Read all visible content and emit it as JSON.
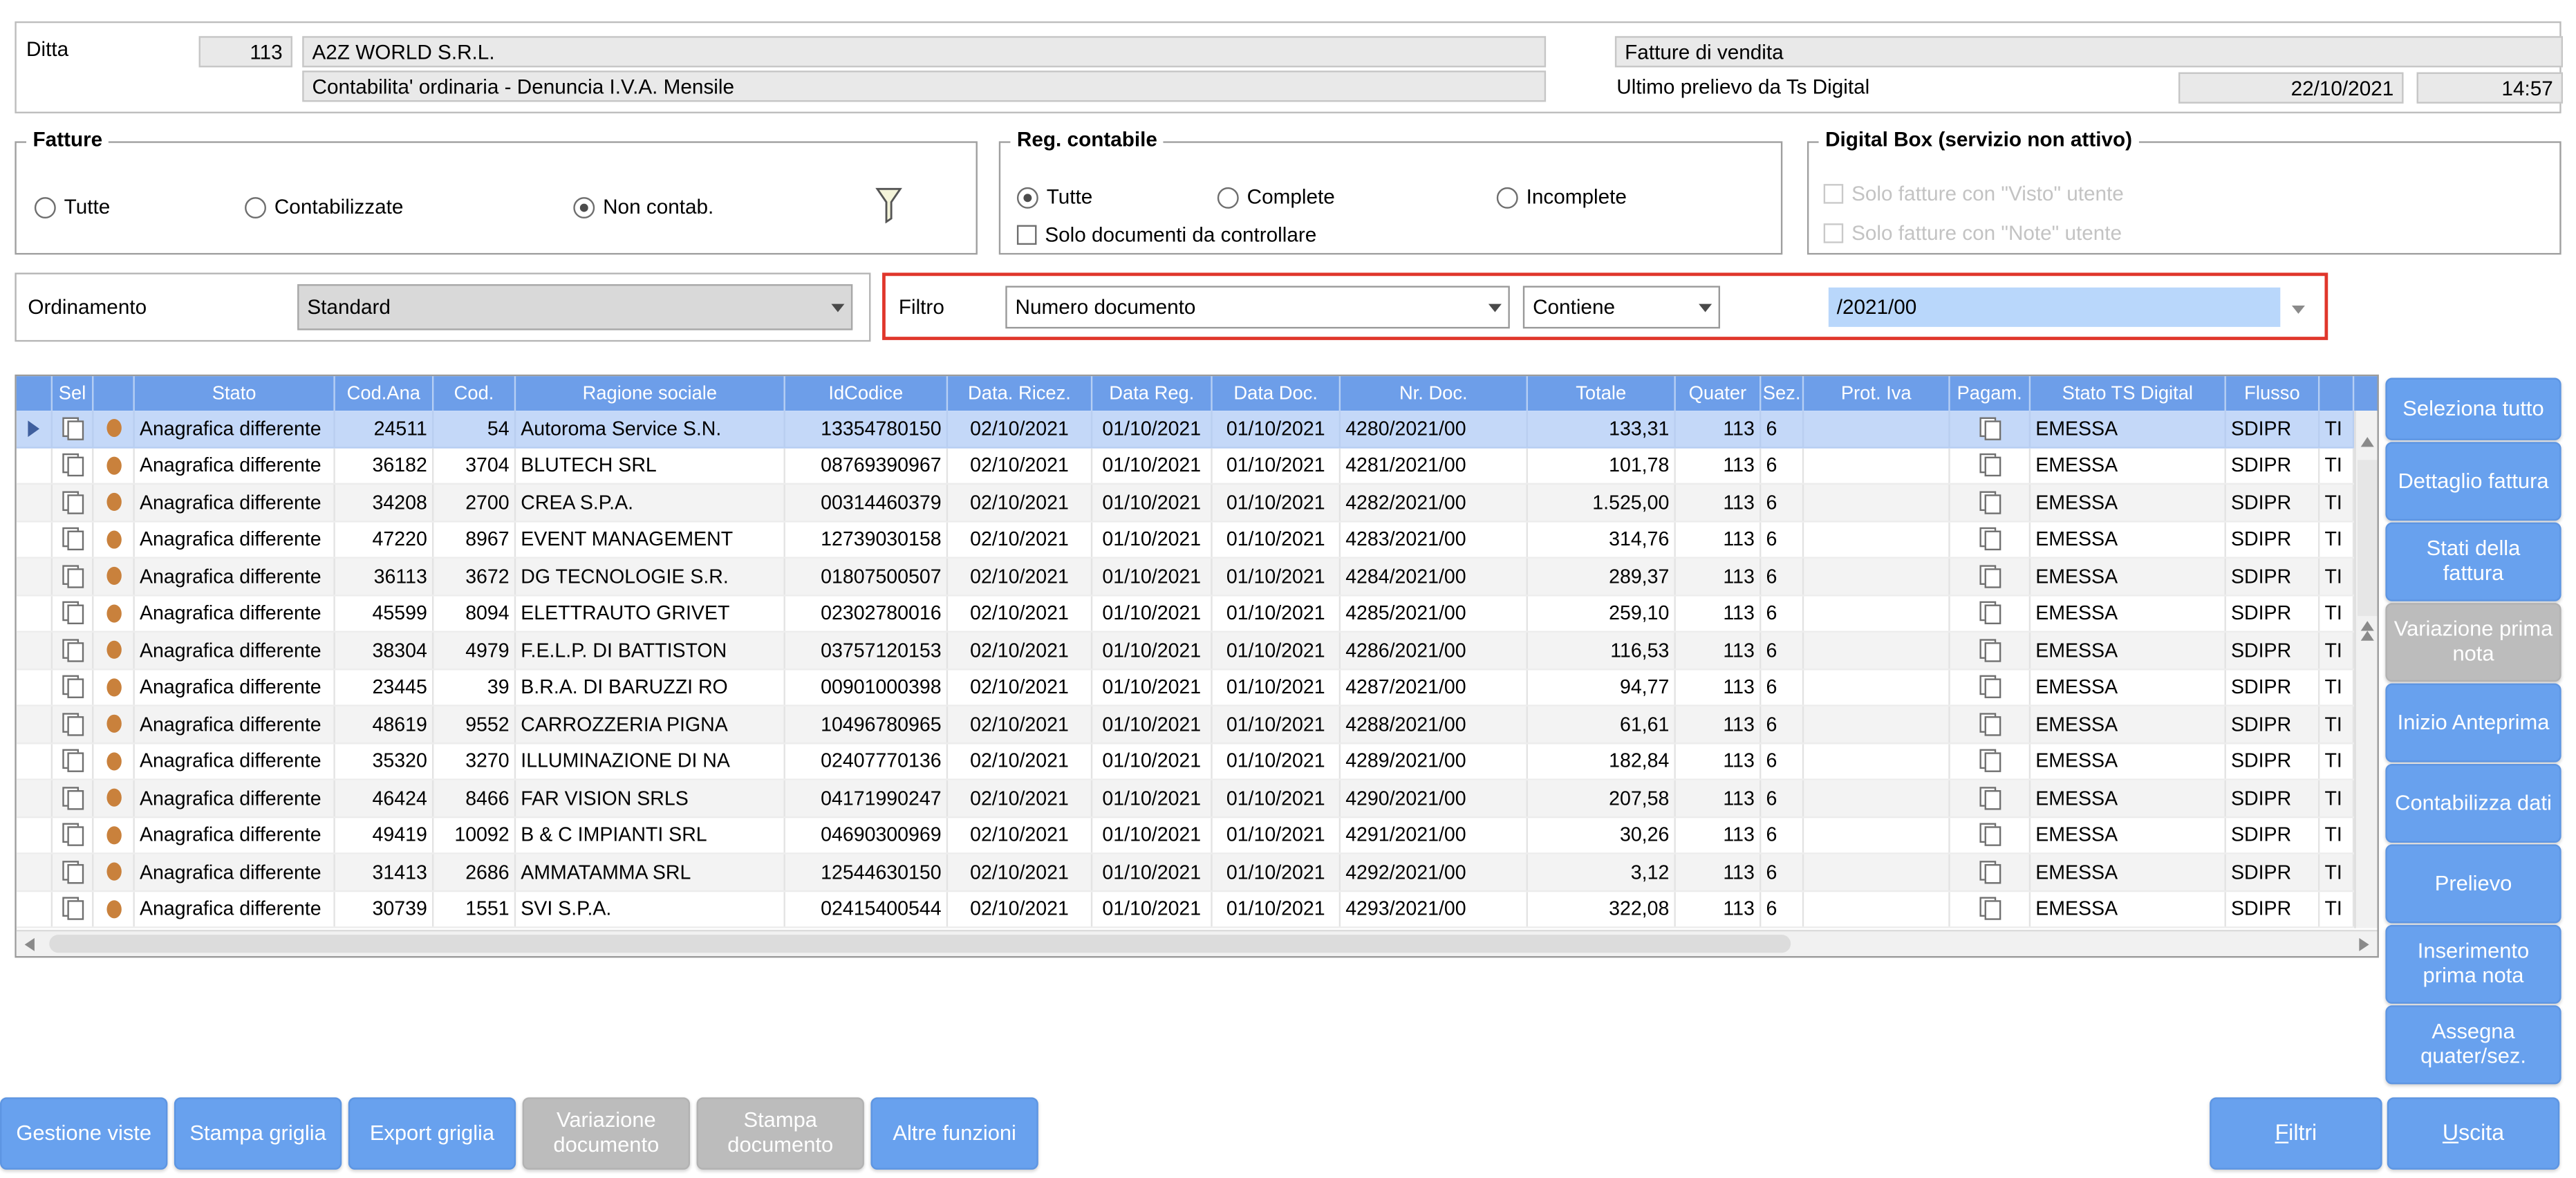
{
  "header": {
    "ditta_label": "Ditta",
    "ditta_code": "113",
    "company_name": "A2Z WORLD S.R.L.",
    "company_subtitle": "Contabilita' ordinaria - Denuncia I.V.A. Mensile",
    "module_title": "Fatture di vendita",
    "last_pull_label": "Ultimo prelievo da Ts Digital",
    "last_pull_date": "22/10/2021",
    "last_pull_time": "14:57"
  },
  "filters": {
    "fatture": {
      "title": "Fatture",
      "options": [
        "Tutte",
        "Contabilizzate",
        "Non contab."
      ],
      "selected": "Non contab."
    },
    "reg_contabile": {
      "title": "Reg. contabile",
      "options": [
        "Tutte",
        "Complete",
        "Incomplete"
      ],
      "selected": "Tutte",
      "checkbox": "Solo documenti da controllare",
      "checkbox_checked": false
    },
    "digital_box": {
      "title": "Digital Box (servizio non attivo)",
      "checkboxes": [
        "Solo fatture con \"Visto\" utente",
        "Solo fatture con \"Note\" utente"
      ],
      "enabled": false
    }
  },
  "ordinamento": {
    "label": "Ordinamento",
    "value": "Standard"
  },
  "filtro": {
    "label": "Filtro",
    "field": "Numero documento",
    "operator": "Contiene",
    "value": "/2021/00"
  },
  "icons": {
    "filter": "funnel-icon",
    "dropdown": "chevron-down-icon",
    "row_indicator": "arrow-right-icon",
    "status_dot": "orange-dot-icon",
    "select_checkbox": "layered-checkbox-icon"
  },
  "colors": {
    "header_blue": "#6d9ee9",
    "selected_row": "#c4d8f8",
    "row_alt": "#f3f3f3",
    "button_blue": "#68a1ee",
    "disabled_gray": "#bcbcbc",
    "accent_red": "#e0362b",
    "highlight_blue": "#b9d7fb",
    "dot_orange": "#c9813c",
    "field_gray": "#e9e9e9"
  },
  "grid": {
    "columns": [
      {
        "key": "ind",
        "label": "",
        "w": 22,
        "align": "center"
      },
      {
        "key": "sel",
        "label": "Sel",
        "w": 25,
        "align": "center"
      },
      {
        "key": "dot",
        "label": "",
        "w": 25,
        "align": "center"
      },
      {
        "key": "stato",
        "label": "Stato",
        "w": 122,
        "align": "left"
      },
      {
        "key": "cod_anag",
        "label": "Cod.Ana",
        "w": 60,
        "align": "right"
      },
      {
        "key": "cod",
        "label": "Cod.",
        "w": 50,
        "align": "right"
      },
      {
        "key": "ragione_sociale",
        "label": "Ragione sociale",
        "w": 164,
        "align": "left"
      },
      {
        "key": "id_codice",
        "label": "IdCodice",
        "w": 99,
        "align": "right"
      },
      {
        "key": "data_ricez",
        "label": "Data. Ricez.",
        "w": 88,
        "align": "center"
      },
      {
        "key": "data_reg",
        "label": "Data Reg.",
        "w": 73,
        "align": "center"
      },
      {
        "key": "data_doc",
        "label": "Data Doc.",
        "w": 78,
        "align": "center"
      },
      {
        "key": "nr_doc",
        "label": "Nr. Doc.",
        "w": 114,
        "align": "left"
      },
      {
        "key": "totale",
        "label": "Totale",
        "w": 90,
        "align": "right"
      },
      {
        "key": "quater",
        "label": "Quater",
        "w": 52,
        "align": "right"
      },
      {
        "key": "sez",
        "label": "Sez.",
        "w": 26,
        "align": "left"
      },
      {
        "key": "prot_iva",
        "label": "Prot. Iva",
        "w": 89,
        "align": "left"
      },
      {
        "key": "pagam",
        "label": "Pagam.",
        "w": 49,
        "align": "center"
      },
      {
        "key": "stato_ts",
        "label": "Stato TS Digital",
        "w": 119,
        "align": "left"
      },
      {
        "key": "flusso",
        "label": "Flusso",
        "w": 57,
        "align": "left"
      },
      {
        "key": "tipo",
        "label": "",
        "w": 21,
        "align": "left"
      }
    ],
    "rows": [
      {
        "selected": true,
        "stato": "Anagrafica differente",
        "cod_anag": "24511",
        "cod": "54",
        "ragione_sociale": "Autoroma Service S.N.",
        "id_codice": "13354780150",
        "data_ricez": "02/10/2021",
        "data_reg": "01/10/2021",
        "data_doc": "01/10/2021",
        "nr_doc": "4280/2021/00",
        "totale": "133,31",
        "quater": "113",
        "sez": "6",
        "prot_iva": "",
        "stato_ts": "EMESSA",
        "flusso": "SDIPR",
        "tipo": "TI"
      },
      {
        "selected": false,
        "stato": "Anagrafica differente",
        "cod_anag": "36182",
        "cod": "3704",
        "ragione_sociale": "BLUTECH SRL",
        "id_codice": "08769390967",
        "data_ricez": "02/10/2021",
        "data_reg": "01/10/2021",
        "data_doc": "01/10/2021",
        "nr_doc": "4281/2021/00",
        "totale": "101,78",
        "quater": "113",
        "sez": "6",
        "prot_iva": "",
        "stato_ts": "EMESSA",
        "flusso": "SDIPR",
        "tipo": "TI"
      },
      {
        "selected": false,
        "stato": "Anagrafica differente",
        "cod_anag": "34208",
        "cod": "2700",
        "ragione_sociale": "CREA S.P.A.",
        "id_codice": "00314460379",
        "data_ricez": "02/10/2021",
        "data_reg": "01/10/2021",
        "data_doc": "01/10/2021",
        "nr_doc": "4282/2021/00",
        "totale": "1.525,00",
        "quater": "113",
        "sez": "6",
        "prot_iva": "",
        "stato_ts": "EMESSA",
        "flusso": "SDIPR",
        "tipo": "TI"
      },
      {
        "selected": false,
        "stato": "Anagrafica differente",
        "cod_anag": "47220",
        "cod": "8967",
        "ragione_sociale": "EVENT MANAGEMENT",
        "id_codice": "12739030158",
        "data_ricez": "02/10/2021",
        "data_reg": "01/10/2021",
        "data_doc": "01/10/2021",
        "nr_doc": "4283/2021/00",
        "totale": "314,76",
        "quater": "113",
        "sez": "6",
        "prot_iva": "",
        "stato_ts": "EMESSA",
        "flusso": "SDIPR",
        "tipo": "TI"
      },
      {
        "selected": false,
        "stato": "Anagrafica differente",
        "cod_anag": "36113",
        "cod": "3672",
        "ragione_sociale": "DG TECNOLOGIE S.R.",
        "id_codice": "01807500507",
        "data_ricez": "02/10/2021",
        "data_reg": "01/10/2021",
        "data_doc": "01/10/2021",
        "nr_doc": "4284/2021/00",
        "totale": "289,37",
        "quater": "113",
        "sez": "6",
        "prot_iva": "",
        "stato_ts": "EMESSA",
        "flusso": "SDIPR",
        "tipo": "TI"
      },
      {
        "selected": false,
        "stato": "Anagrafica differente",
        "cod_anag": "45599",
        "cod": "8094",
        "ragione_sociale": "ELETTRAUTO GRIVET",
        "id_codice": "02302780016",
        "data_ricez": "02/10/2021",
        "data_reg": "01/10/2021",
        "data_doc": "01/10/2021",
        "nr_doc": "4285/2021/00",
        "totale": "259,10",
        "quater": "113",
        "sez": "6",
        "prot_iva": "",
        "stato_ts": "EMESSA",
        "flusso": "SDIPR",
        "tipo": "TI"
      },
      {
        "selected": false,
        "stato": "Anagrafica differente",
        "cod_anag": "38304",
        "cod": "4979",
        "ragione_sociale": "F.E.L.P. DI BATTISTON",
        "id_codice": "03757120153",
        "data_ricez": "02/10/2021",
        "data_reg": "01/10/2021",
        "data_doc": "01/10/2021",
        "nr_doc": "4286/2021/00",
        "totale": "116,53",
        "quater": "113",
        "sez": "6",
        "prot_iva": "",
        "stato_ts": "EMESSA",
        "flusso": "SDIPR",
        "tipo": "TI"
      },
      {
        "selected": false,
        "stato": "Anagrafica differente",
        "cod_anag": "23445",
        "cod": "39",
        "ragione_sociale": "B.R.A. DI BARUZZI RO",
        "id_codice": "00901000398",
        "data_ricez": "02/10/2021",
        "data_reg": "01/10/2021",
        "data_doc": "01/10/2021",
        "nr_doc": "4287/2021/00",
        "totale": "94,77",
        "quater": "113",
        "sez": "6",
        "prot_iva": "",
        "stato_ts": "EMESSA",
        "flusso": "SDIPR",
        "tipo": "TI"
      },
      {
        "selected": false,
        "stato": "Anagrafica differente",
        "cod_anag": "48619",
        "cod": "9552",
        "ragione_sociale": "CARROZZERIA PIGNA",
        "id_codice": "10496780965",
        "data_ricez": "02/10/2021",
        "data_reg": "01/10/2021",
        "data_doc": "01/10/2021",
        "nr_doc": "4288/2021/00",
        "totale": "61,61",
        "quater": "113",
        "sez": "6",
        "prot_iva": "",
        "stato_ts": "EMESSA",
        "flusso": "SDIPR",
        "tipo": "TI"
      },
      {
        "selected": false,
        "stato": "Anagrafica differente",
        "cod_anag": "35320",
        "cod": "3270",
        "ragione_sociale": "ILLUMINAZIONE DI NA",
        "id_codice": "02407770136",
        "data_ricez": "02/10/2021",
        "data_reg": "01/10/2021",
        "data_doc": "01/10/2021",
        "nr_doc": "4289/2021/00",
        "totale": "182,84",
        "quater": "113",
        "sez": "6",
        "prot_iva": "",
        "stato_ts": "EMESSA",
        "flusso": "SDIPR",
        "tipo": "TI"
      },
      {
        "selected": false,
        "stato": "Anagrafica differente",
        "cod_anag": "46424",
        "cod": "8466",
        "ragione_sociale": "FAR VISION SRLS",
        "id_codice": "04171990247",
        "data_ricez": "02/10/2021",
        "data_reg": "01/10/2021",
        "data_doc": "01/10/2021",
        "nr_doc": "4290/2021/00",
        "totale": "207,58",
        "quater": "113",
        "sez": "6",
        "prot_iva": "",
        "stato_ts": "EMESSA",
        "flusso": "SDIPR",
        "tipo": "TI"
      },
      {
        "selected": false,
        "stato": "Anagrafica differente",
        "cod_anag": "49419",
        "cod": "10092",
        "ragione_sociale": "B & C IMPIANTI SRL",
        "id_codice": "04690300969",
        "data_ricez": "02/10/2021",
        "data_reg": "01/10/2021",
        "data_doc": "01/10/2021",
        "nr_doc": "4291/2021/00",
        "totale": "30,26",
        "quater": "113",
        "sez": "6",
        "prot_iva": "",
        "stato_ts": "EMESSA",
        "flusso": "SDIPR",
        "tipo": "TI"
      },
      {
        "selected": false,
        "stato": "Anagrafica differente",
        "cod_anag": "31413",
        "cod": "2686",
        "ragione_sociale": "AMMATAMMA SRL",
        "id_codice": "12544630150",
        "data_ricez": "02/10/2021",
        "data_reg": "01/10/2021",
        "data_doc": "01/10/2021",
        "nr_doc": "4292/2021/00",
        "totale": "3,12",
        "quater": "113",
        "sez": "6",
        "prot_iva": "",
        "stato_ts": "EMESSA",
        "flusso": "SDIPR",
        "tipo": "TI"
      },
      {
        "selected": false,
        "stato": "Anagrafica differente",
        "cod_anag": "30739",
        "cod": "1551",
        "ragione_sociale": "SVI S.P.A.",
        "id_codice": "02415400544",
        "data_ricez": "02/10/2021",
        "data_reg": "01/10/2021",
        "data_doc": "01/10/2021",
        "nr_doc": "4293/2021/00",
        "totale": "322,08",
        "quater": "113",
        "sez": "6",
        "prot_iva": "",
        "stato_ts": "EMESSA",
        "flusso": "SDIPR",
        "tipo": "TI"
      }
    ]
  },
  "side_buttons": [
    {
      "label": "Seleziona tutto",
      "enabled": true
    },
    {
      "label": "Dettaglio fattura",
      "enabled": true
    },
    {
      "label": "Stati della fattura",
      "enabled": true
    },
    {
      "label": "Variazione prima nota",
      "enabled": false
    },
    {
      "label": "Inizio Anteprima",
      "enabled": true
    },
    {
      "label": "Contabilizza dati",
      "enabled": true
    },
    {
      "label": "Prelievo",
      "enabled": true
    },
    {
      "label": "Inserimento prima nota",
      "enabled": true
    },
    {
      "label": "Assegna quater/sez.",
      "enabled": true
    }
  ],
  "bottom_buttons": [
    {
      "label": "Gestione viste",
      "enabled": true
    },
    {
      "label": "Stampa griglia",
      "enabled": true
    },
    {
      "label": "Export griglia",
      "enabled": true
    },
    {
      "label": "Variazione documento",
      "enabled": false
    },
    {
      "label": "Stampa documento",
      "enabled": false
    },
    {
      "label": "Altre funzioni",
      "enabled": true
    }
  ],
  "footer_buttons": [
    {
      "label": "Filtri",
      "underline_first": true,
      "enabled": true
    },
    {
      "label": "Uscita",
      "underline_first": true,
      "enabled": true
    }
  ]
}
